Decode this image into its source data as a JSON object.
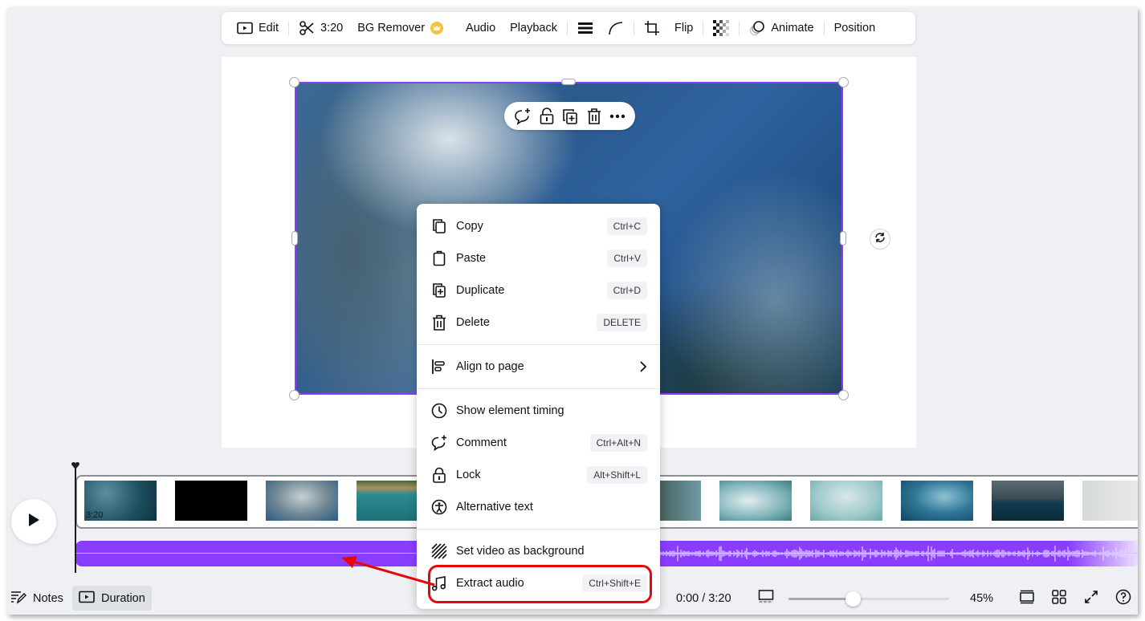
{
  "toolbar": {
    "edit_label": "Edit",
    "duration_label": "3:20",
    "bg_remover_label": "BG Remover",
    "audio_label": "Audio",
    "playback_label": "Playback",
    "flip_label": "Flip",
    "animate_label": "Animate",
    "position_label": "Position",
    "icons": [
      "play-box-icon",
      "scissors-icon",
      "crown-icon",
      "border-style-icon",
      "corner-rounding-icon",
      "crop-icon",
      "transparency-icon",
      "animate-icon"
    ]
  },
  "element_bar": {
    "icons": [
      "comment-add-icon",
      "lock-icon",
      "duplicate-icon",
      "trash-icon",
      "more-icon"
    ]
  },
  "context_menu": {
    "groups": [
      [
        {
          "label": "Copy",
          "shortcut": "Ctrl+C",
          "icon": "copy-icon"
        },
        {
          "label": "Paste",
          "shortcut": "Ctrl+V",
          "icon": "paste-icon"
        },
        {
          "label": "Duplicate",
          "shortcut": "Ctrl+D",
          "icon": "duplicate-icon"
        },
        {
          "label": "Delete",
          "shortcut": "DELETE",
          "icon": "trash-icon"
        }
      ],
      [
        {
          "label": "Align to page",
          "shortcut": "",
          "icon": "align-icon",
          "submenu": true
        }
      ],
      [
        {
          "label": "Show element timing",
          "shortcut": "",
          "icon": "clock-icon"
        },
        {
          "label": "Comment",
          "shortcut": "Ctrl+Alt+N",
          "icon": "comment-add-icon"
        },
        {
          "label": "Lock",
          "shortcut": "Alt+Shift+L",
          "icon": "lock-icon"
        },
        {
          "label": "Alternative text",
          "shortcut": "",
          "icon": "accessibility-icon"
        }
      ],
      [
        {
          "label": "Set video as background",
          "shortcut": "",
          "icon": "background-hatch-icon"
        },
        {
          "label": "Extract audio",
          "shortcut": "Ctrl+Shift+E",
          "icon": "music-note-icon",
          "highlighted": true
        }
      ]
    ]
  },
  "timeline": {
    "clip_duration": "3:20",
    "thumbnail_count": 12
  },
  "bottom_bar": {
    "notes_label": "Notes",
    "duration_label": "Duration",
    "time_readout": "0:00 / 3:20",
    "zoom_percent": "45%",
    "zoom_fraction": 0.4
  },
  "colors": {
    "accent": "#8b3dff",
    "annotation_red": "#e4080a",
    "crown": "#f6c23e",
    "app_background": "#eef0f3"
  }
}
